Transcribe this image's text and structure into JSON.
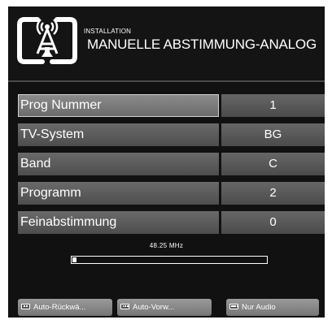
{
  "header": {
    "section": "INSTALLATION",
    "title": "MANUELLE ABSTIMMUNG-ANALOG"
  },
  "menu": {
    "rows": [
      {
        "label": "Prog Nummer",
        "value": "1",
        "selected": true
      },
      {
        "label": "TV-System",
        "value": "BG",
        "selected": false
      },
      {
        "label": "Band",
        "value": "C",
        "selected": false
      },
      {
        "label": "Programm",
        "value": "2",
        "selected": false
      },
      {
        "label": "Feinabstimmung",
        "value": "0",
        "selected": false
      }
    ]
  },
  "tuning": {
    "frequency": "48.25 MHz",
    "progress": 0.02
  },
  "buttons": {
    "back": "Auto-Rückwä...",
    "forward": "Auto-Vorw...",
    "audio": "Nur Audio"
  },
  "icons": {
    "logo": "tv-antenna-icon",
    "key_back": "remote-key-icon",
    "key_forward": "remote-key-icon",
    "key_audio": "remote-key-icon"
  },
  "colors": {
    "background": "#111111",
    "row": "#5a5a5a",
    "row_selected": "#7c7c7c",
    "button": "#888888",
    "text": "#ffffff"
  }
}
